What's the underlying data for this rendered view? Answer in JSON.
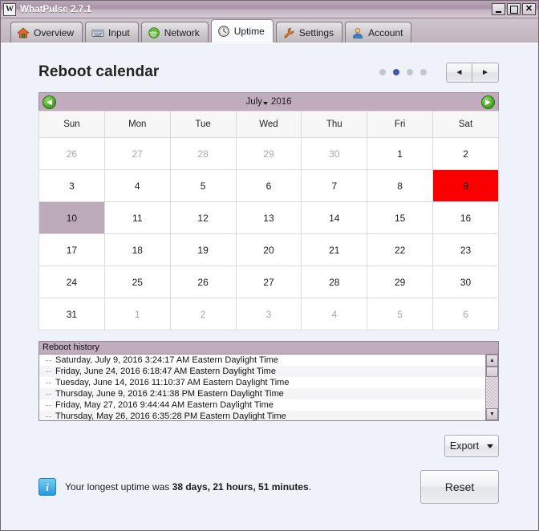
{
  "window": {
    "title": "WhatPulse 2.7.1",
    "logo_letter": "W",
    "controls": {
      "minimize": "Minimize",
      "maximize": "Maximize",
      "close": "Close"
    }
  },
  "tabs": [
    {
      "label": "Overview",
      "icon": "house-icon",
      "active": false
    },
    {
      "label": "Input",
      "icon": "keyboard-icon",
      "active": false
    },
    {
      "label": "Network",
      "icon": "globe-icon",
      "active": false
    },
    {
      "label": "Uptime",
      "icon": "clock-icon",
      "active": true
    },
    {
      "label": "Settings",
      "icon": "wrench-icon",
      "active": false
    },
    {
      "label": "Account",
      "icon": "person-icon",
      "active": false
    }
  ],
  "page": {
    "title": "Reboot calendar",
    "pager": {
      "total_dots": 4,
      "active_index": 1
    },
    "nav": {
      "prev": "◄",
      "next": "►"
    }
  },
  "calendar": {
    "prev_arrow": "◀",
    "next_arrow": "▶",
    "month": "July",
    "year": "2016",
    "weekdays": [
      "Sun",
      "Mon",
      "Tue",
      "Wed",
      "Thu",
      "Fri",
      "Sat"
    ],
    "weeks": [
      [
        {
          "day": "26",
          "state": "out"
        },
        {
          "day": "27",
          "state": "out"
        },
        {
          "day": "28",
          "state": "out"
        },
        {
          "day": "29",
          "state": "out"
        },
        {
          "day": "30",
          "state": "out"
        },
        {
          "day": "1",
          "state": "normal"
        },
        {
          "day": "2",
          "state": "normal"
        }
      ],
      [
        {
          "day": "3",
          "state": "normal"
        },
        {
          "day": "4",
          "state": "normal"
        },
        {
          "day": "5",
          "state": "normal"
        },
        {
          "day": "6",
          "state": "normal"
        },
        {
          "day": "7",
          "state": "normal"
        },
        {
          "day": "8",
          "state": "normal"
        },
        {
          "day": "9",
          "state": "reboot"
        }
      ],
      [
        {
          "day": "10",
          "state": "sel"
        },
        {
          "day": "11",
          "state": "normal"
        },
        {
          "day": "12",
          "state": "normal"
        },
        {
          "day": "13",
          "state": "normal"
        },
        {
          "day": "14",
          "state": "normal"
        },
        {
          "day": "15",
          "state": "normal"
        },
        {
          "day": "16",
          "state": "normal"
        }
      ],
      [
        {
          "day": "17",
          "state": "normal"
        },
        {
          "day": "18",
          "state": "normal"
        },
        {
          "day": "19",
          "state": "normal"
        },
        {
          "day": "20",
          "state": "normal"
        },
        {
          "day": "21",
          "state": "normal"
        },
        {
          "day": "22",
          "state": "normal"
        },
        {
          "day": "23",
          "state": "normal"
        }
      ],
      [
        {
          "day": "24",
          "state": "normal"
        },
        {
          "day": "25",
          "state": "normal"
        },
        {
          "day": "26",
          "state": "normal"
        },
        {
          "day": "27",
          "state": "normal"
        },
        {
          "day": "28",
          "state": "normal"
        },
        {
          "day": "29",
          "state": "normal"
        },
        {
          "day": "30",
          "state": "normal"
        }
      ],
      [
        {
          "day": "31",
          "state": "normal"
        },
        {
          "day": "1",
          "state": "out"
        },
        {
          "day": "2",
          "state": "out"
        },
        {
          "day": "3",
          "state": "out"
        },
        {
          "day": "4",
          "state": "out"
        },
        {
          "day": "5",
          "state": "out"
        },
        {
          "day": "6",
          "state": "out"
        }
      ]
    ],
    "selected_day": "10",
    "reboot_day": "9",
    "colors": {
      "header_bar": "#c0acbc",
      "reboot": "#fb0000",
      "selected": "#bcaab8"
    }
  },
  "history": {
    "header": "Reboot history",
    "entries": [
      "Saturday, July 9, 2016 3:24:17 AM Eastern Daylight Time",
      "Friday, June 24, 2016 6:18:47 AM Eastern Daylight Time",
      "Tuesday, June 14, 2016 11:10:37 AM Eastern Daylight Time",
      "Thursday, June 9, 2016 2:41:38 PM Eastern Daylight Time",
      "Friday, May 27, 2016 9:44:44 AM Eastern Daylight Time",
      "Thursday, May 26, 2016 6:35:28 PM Eastern Daylight Time"
    ],
    "scrollbar": {
      "up": "▲",
      "down": "▼"
    }
  },
  "actions": {
    "export_label": "Export",
    "reset_label": "Reset"
  },
  "status": {
    "prefix": "Your longest uptime was ",
    "value": "38 days, 21 hours, 51 minutes",
    "suffix": ".",
    "icon": "info-icon",
    "icon_glyph": "i"
  }
}
